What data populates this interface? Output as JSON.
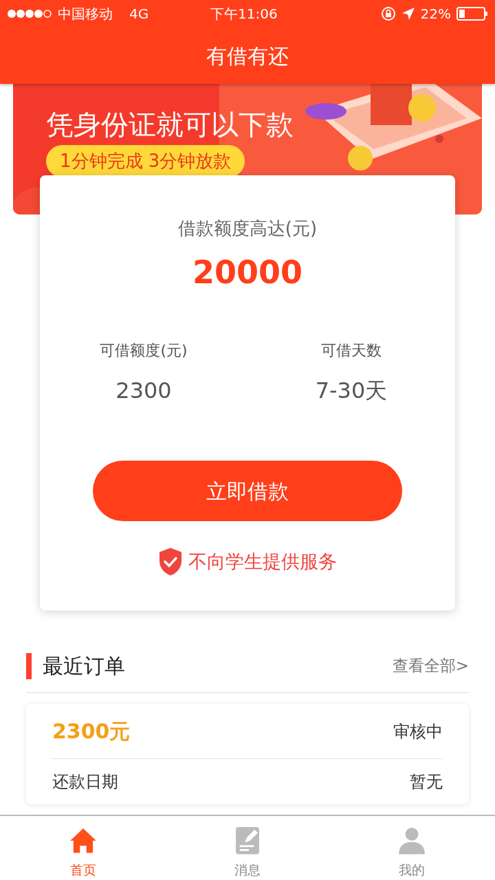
{
  "status_bar": {
    "carrier": "中国移动",
    "network": "4G",
    "time": "下午11:06",
    "battery": "22%"
  },
  "nav": {
    "title": "有借有还"
  },
  "banner": {
    "headline": "凭身份证就可以下款",
    "tag": "1分钟完成 3分钟放款"
  },
  "loan_card": {
    "limit_label": "借款额度高达(元)",
    "limit_value": "20000",
    "stats": [
      {
        "label": "可借额度(元)",
        "value": "2300"
      },
      {
        "label": "可借天数",
        "value": "7-30天"
      }
    ],
    "button": "立即借款",
    "notice": "不向学生提供服务"
  },
  "orders": {
    "title": "最近订单",
    "link": "查看全部>",
    "items": [
      {
        "amount": "2300元",
        "status": "审核中",
        "date_label": "还款日期",
        "date_value": "暂无"
      }
    ]
  },
  "tabs": [
    {
      "label": "首页",
      "selected": true
    },
    {
      "label": "消息",
      "selected": false
    },
    {
      "label": "我的",
      "selected": false
    }
  ]
}
